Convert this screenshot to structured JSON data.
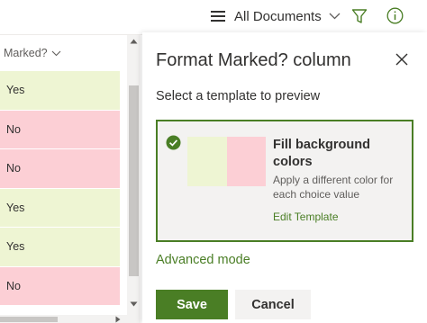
{
  "command_bar": {
    "view_label": "All Documents",
    "icons": [
      "hamburger-icon",
      "chevron-down-icon",
      "filter-icon",
      "info-icon"
    ]
  },
  "list": {
    "column_header": "Marked?",
    "rows": [
      {
        "value": "Yes"
      },
      {
        "value": "No"
      },
      {
        "value": "No"
      },
      {
        "value": "Yes"
      },
      {
        "value": "Yes"
      },
      {
        "value": "No"
      }
    ]
  },
  "panel": {
    "title": "Format Marked? column",
    "subtitle": "Select a template to preview",
    "template": {
      "title": "Fill background colors",
      "description": "Apply a different color for each choice value",
      "edit_link": "Edit Template"
    },
    "advanced_mode": "Advanced mode",
    "save_label": "Save",
    "cancel_label": "Cancel"
  },
  "colors": {
    "accent": "#4a7e25",
    "yes_fill": "#eef5d3",
    "no_fill": "#fccfd5"
  }
}
